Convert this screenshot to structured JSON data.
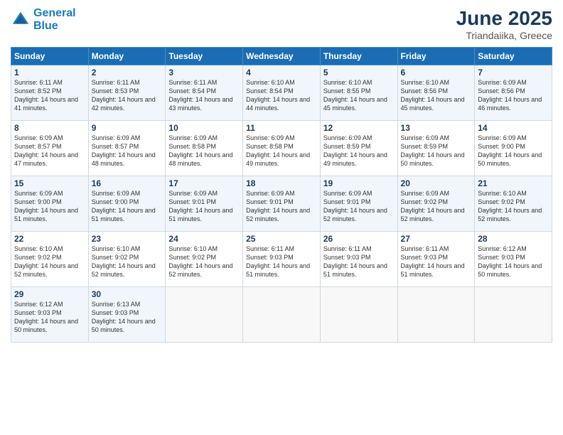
{
  "header": {
    "logo_line1": "General",
    "logo_line2": "Blue",
    "month": "June 2025",
    "location": "Triandaiika, Greece"
  },
  "days_of_week": [
    "Sunday",
    "Monday",
    "Tuesday",
    "Wednesday",
    "Thursday",
    "Friday",
    "Saturday"
  ],
  "weeks": [
    [
      {
        "day": "1",
        "sunrise": "Sunrise: 6:11 AM",
        "sunset": "Sunset: 8:52 PM",
        "daylight": "Daylight: 14 hours and 41 minutes."
      },
      {
        "day": "2",
        "sunrise": "Sunrise: 6:11 AM",
        "sunset": "Sunset: 8:53 PM",
        "daylight": "Daylight: 14 hours and 42 minutes."
      },
      {
        "day": "3",
        "sunrise": "Sunrise: 6:11 AM",
        "sunset": "Sunset: 8:54 PM",
        "daylight": "Daylight: 14 hours and 43 minutes."
      },
      {
        "day": "4",
        "sunrise": "Sunrise: 6:10 AM",
        "sunset": "Sunset: 8:54 PM",
        "daylight": "Daylight: 14 hours and 44 minutes."
      },
      {
        "day": "5",
        "sunrise": "Sunrise: 6:10 AM",
        "sunset": "Sunset: 8:55 PM",
        "daylight": "Daylight: 14 hours and 45 minutes."
      },
      {
        "day": "6",
        "sunrise": "Sunrise: 6:10 AM",
        "sunset": "Sunset: 8:56 PM",
        "daylight": "Daylight: 14 hours and 45 minutes."
      },
      {
        "day": "7",
        "sunrise": "Sunrise: 6:09 AM",
        "sunset": "Sunset: 8:56 PM",
        "daylight": "Daylight: 14 hours and 46 minutes."
      }
    ],
    [
      {
        "day": "8",
        "sunrise": "Sunrise: 6:09 AM",
        "sunset": "Sunset: 8:57 PM",
        "daylight": "Daylight: 14 hours and 47 minutes."
      },
      {
        "day": "9",
        "sunrise": "Sunrise: 6:09 AM",
        "sunset": "Sunset: 8:57 PM",
        "daylight": "Daylight: 14 hours and 48 minutes."
      },
      {
        "day": "10",
        "sunrise": "Sunrise: 6:09 AM",
        "sunset": "Sunset: 8:58 PM",
        "daylight": "Daylight: 14 hours and 48 minutes."
      },
      {
        "day": "11",
        "sunrise": "Sunrise: 6:09 AM",
        "sunset": "Sunset: 8:58 PM",
        "daylight": "Daylight: 14 hours and 49 minutes."
      },
      {
        "day": "12",
        "sunrise": "Sunrise: 6:09 AM",
        "sunset": "Sunset: 8:59 PM",
        "daylight": "Daylight: 14 hours and 49 minutes."
      },
      {
        "day": "13",
        "sunrise": "Sunrise: 6:09 AM",
        "sunset": "Sunset: 8:59 PM",
        "daylight": "Daylight: 14 hours and 50 minutes."
      },
      {
        "day": "14",
        "sunrise": "Sunrise: 6:09 AM",
        "sunset": "Sunset: 9:00 PM",
        "daylight": "Daylight: 14 hours and 50 minutes."
      }
    ],
    [
      {
        "day": "15",
        "sunrise": "Sunrise: 6:09 AM",
        "sunset": "Sunset: 9:00 PM",
        "daylight": "Daylight: 14 hours and 51 minutes."
      },
      {
        "day": "16",
        "sunrise": "Sunrise: 6:09 AM",
        "sunset": "Sunset: 9:00 PM",
        "daylight": "Daylight: 14 hours and 51 minutes."
      },
      {
        "day": "17",
        "sunrise": "Sunrise: 6:09 AM",
        "sunset": "Sunset: 9:01 PM",
        "daylight": "Daylight: 14 hours and 51 minutes."
      },
      {
        "day": "18",
        "sunrise": "Sunrise: 6:09 AM",
        "sunset": "Sunset: 9:01 PM",
        "daylight": "Daylight: 14 hours and 52 minutes."
      },
      {
        "day": "19",
        "sunrise": "Sunrise: 6:09 AM",
        "sunset": "Sunset: 9:01 PM",
        "daylight": "Daylight: 14 hours and 52 minutes."
      },
      {
        "day": "20",
        "sunrise": "Sunrise: 6:09 AM",
        "sunset": "Sunset: 9:02 PM",
        "daylight": "Daylight: 14 hours and 52 minutes."
      },
      {
        "day": "21",
        "sunrise": "Sunrise: 6:10 AM",
        "sunset": "Sunset: 9:02 PM",
        "daylight": "Daylight: 14 hours and 52 minutes."
      }
    ],
    [
      {
        "day": "22",
        "sunrise": "Sunrise: 6:10 AM",
        "sunset": "Sunset: 9:02 PM",
        "daylight": "Daylight: 14 hours and 52 minutes."
      },
      {
        "day": "23",
        "sunrise": "Sunrise: 6:10 AM",
        "sunset": "Sunset: 9:02 PM",
        "daylight": "Daylight: 14 hours and 52 minutes."
      },
      {
        "day": "24",
        "sunrise": "Sunrise: 6:10 AM",
        "sunset": "Sunset: 9:02 PM",
        "daylight": "Daylight: 14 hours and 52 minutes."
      },
      {
        "day": "25",
        "sunrise": "Sunrise: 6:11 AM",
        "sunset": "Sunset: 9:03 PM",
        "daylight": "Daylight: 14 hours and 51 minutes."
      },
      {
        "day": "26",
        "sunrise": "Sunrise: 6:11 AM",
        "sunset": "Sunset: 9:03 PM",
        "daylight": "Daylight: 14 hours and 51 minutes."
      },
      {
        "day": "27",
        "sunrise": "Sunrise: 6:11 AM",
        "sunset": "Sunset: 9:03 PM",
        "daylight": "Daylight: 14 hours and 51 minutes."
      },
      {
        "day": "28",
        "sunrise": "Sunrise: 6:12 AM",
        "sunset": "Sunset: 9:03 PM",
        "daylight": "Daylight: 14 hours and 50 minutes."
      }
    ],
    [
      {
        "day": "29",
        "sunrise": "Sunrise: 6:12 AM",
        "sunset": "Sunset: 9:03 PM",
        "daylight": "Daylight: 14 hours and 50 minutes."
      },
      {
        "day": "30",
        "sunrise": "Sunrise: 6:13 AM",
        "sunset": "Sunset: 9:03 PM",
        "daylight": "Daylight: 14 hours and 50 minutes."
      },
      null,
      null,
      null,
      null,
      null
    ]
  ]
}
